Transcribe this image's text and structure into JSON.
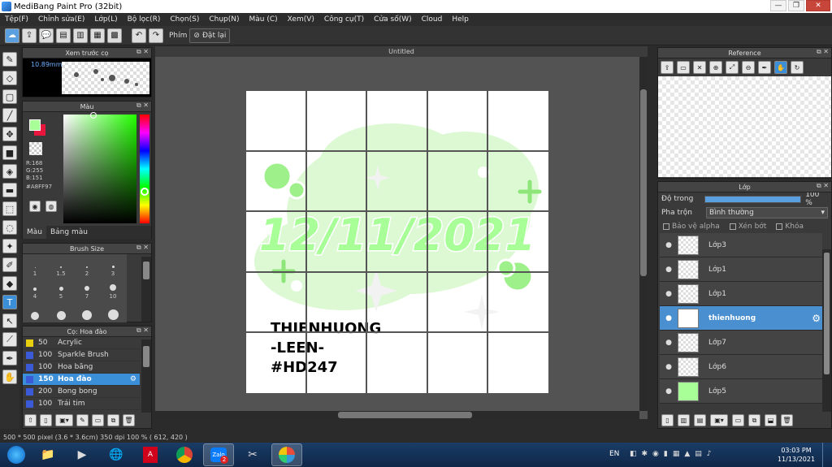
{
  "window": {
    "title": "MediBang Paint Pro (32bit)"
  },
  "menu": [
    "Tệp(F)",
    "Chỉnh sửa(E)",
    "Lớp(L)",
    "Bộ lọc(R)",
    "Chọn(S)",
    "Chụp(N)",
    "Màu (C)",
    "Xem(V)",
    "Công cụ(T)",
    "Cửa số(W)",
    "Cloud",
    "Help"
  ],
  "toolbar": {
    "key_label": "Phím",
    "reset_label": "Đặt lại"
  },
  "brush_preview": {
    "title": "Xem trước cọ",
    "size": "10.89mm"
  },
  "color_panel": {
    "title": "Màu",
    "r": "R:168",
    "g": "G:255",
    "b": "B:151",
    "hex": "#A8FF97",
    "tab1": "Màu",
    "tab2": "Bảng màu",
    "fg": "#A8FF97",
    "bg": "#E8163C"
  },
  "brush_size": {
    "title": "Brush Size",
    "sizes": [
      "1",
      "1.5",
      "2",
      "3",
      "4",
      "5",
      "7",
      "10"
    ]
  },
  "brush_list": {
    "title": "Cọ: Hoa đào",
    "items": [
      {
        "size": "50",
        "name": "Acrylic",
        "color": "#e8d010"
      },
      {
        "size": "100",
        "name": "Sparkle Brush",
        "color": "#3a5ad8"
      },
      {
        "size": "100",
        "name": "Hoa băng",
        "color": "#3a5ad8"
      },
      {
        "size": "150",
        "name": "Hoa đào",
        "color": "#3a5ad8"
      },
      {
        "size": "200",
        "name": "Bong bong",
        "color": "#3a5ad8"
      },
      {
        "size": "100",
        "name": "Trái tim",
        "color": "#3a5ad8"
      }
    ]
  },
  "document": {
    "tab": "Untitled",
    "date_art": "12/11/2021",
    "credit_lines": [
      "THIENHUONG",
      "-LEEN-",
      "#HD247"
    ]
  },
  "reference": {
    "title": "Reference"
  },
  "layers": {
    "title": "Lớp",
    "opacity_label": "Độ trong",
    "opacity_value": "100 %",
    "opacity": 1.0,
    "blend_label": "Pha trộn",
    "blend_value": "Bình thường",
    "protect_alpha": "Bảo vệ alpha",
    "clipping": "Xén bớt",
    "lock": "Khóa",
    "items": [
      "Lớp3",
      "Lớp1",
      "Lớp1",
      "thienhuong",
      "Lớp7",
      "Lớp6",
      "Lớp5"
    ]
  },
  "status": {
    "text": "500 * 500 pixel   (3.6 * 3.6cm)   350 dpi   100 %   ( 612, 420 )"
  },
  "taskbar": {
    "lang": "EN",
    "time": "03:03 PM",
    "date": "11/13/2021",
    "zalo_badge": "2"
  }
}
